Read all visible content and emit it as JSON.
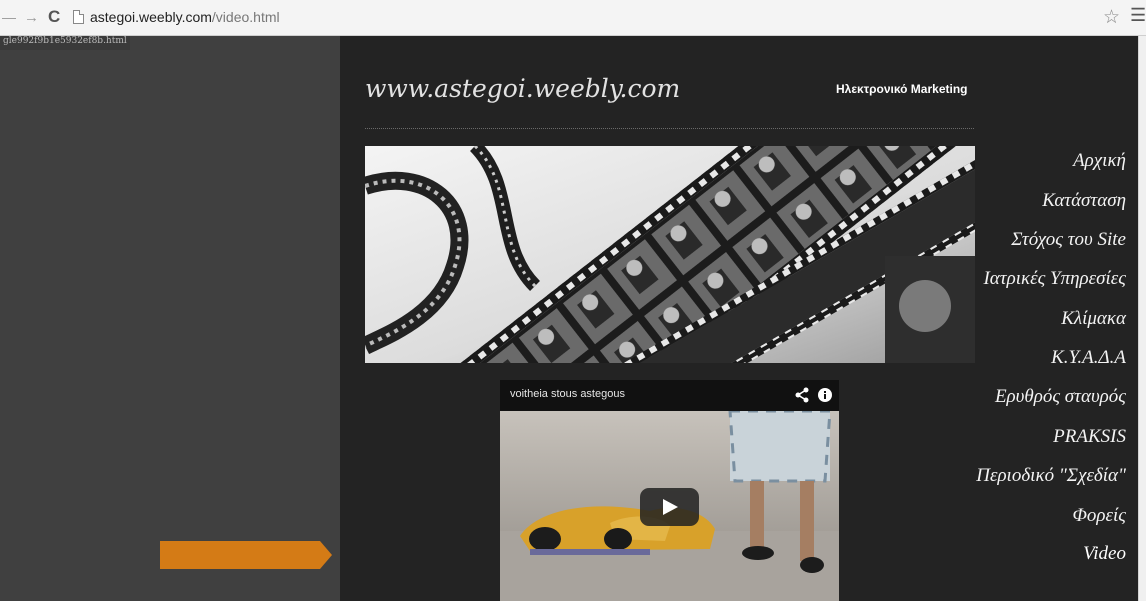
{
  "browser": {
    "url_host": "astegoi.weebly.com",
    "url_path": "/video.html",
    "star_icon": "star-icon",
    "menu_icon": "hamburger-menu-icon"
  },
  "status_link": "gle992f9b1e5932ef8b.html",
  "site": {
    "title": "www.astegoi.weebly.com",
    "header_link": "Ηλεκτρονικό Marketing",
    "accent_color": "#d47b16"
  },
  "nav": {
    "items": [
      {
        "label": "Αρχική"
      },
      {
        "label": "Κατάσταση"
      },
      {
        "label": "Στόχος του Site"
      },
      {
        "label": "Ιατρικές Υπηρεσίες"
      },
      {
        "label": "Κλίμακα"
      },
      {
        "label": "Κ.Υ.Α.Δ.Α"
      },
      {
        "label": "Ερυθρός σταυρός"
      },
      {
        "label": "PRAKSIS"
      },
      {
        "label": "Περιοδικό \"Σχεδία\""
      },
      {
        "label": "Φορείς"
      }
    ],
    "active": "Video"
  },
  "banner": {
    "icon": "film-strip-banner"
  },
  "video": {
    "title": "voitheia stous astegous",
    "share_icon": "share-icon",
    "info_icon": "info-icon",
    "play_icon": "play-icon"
  }
}
